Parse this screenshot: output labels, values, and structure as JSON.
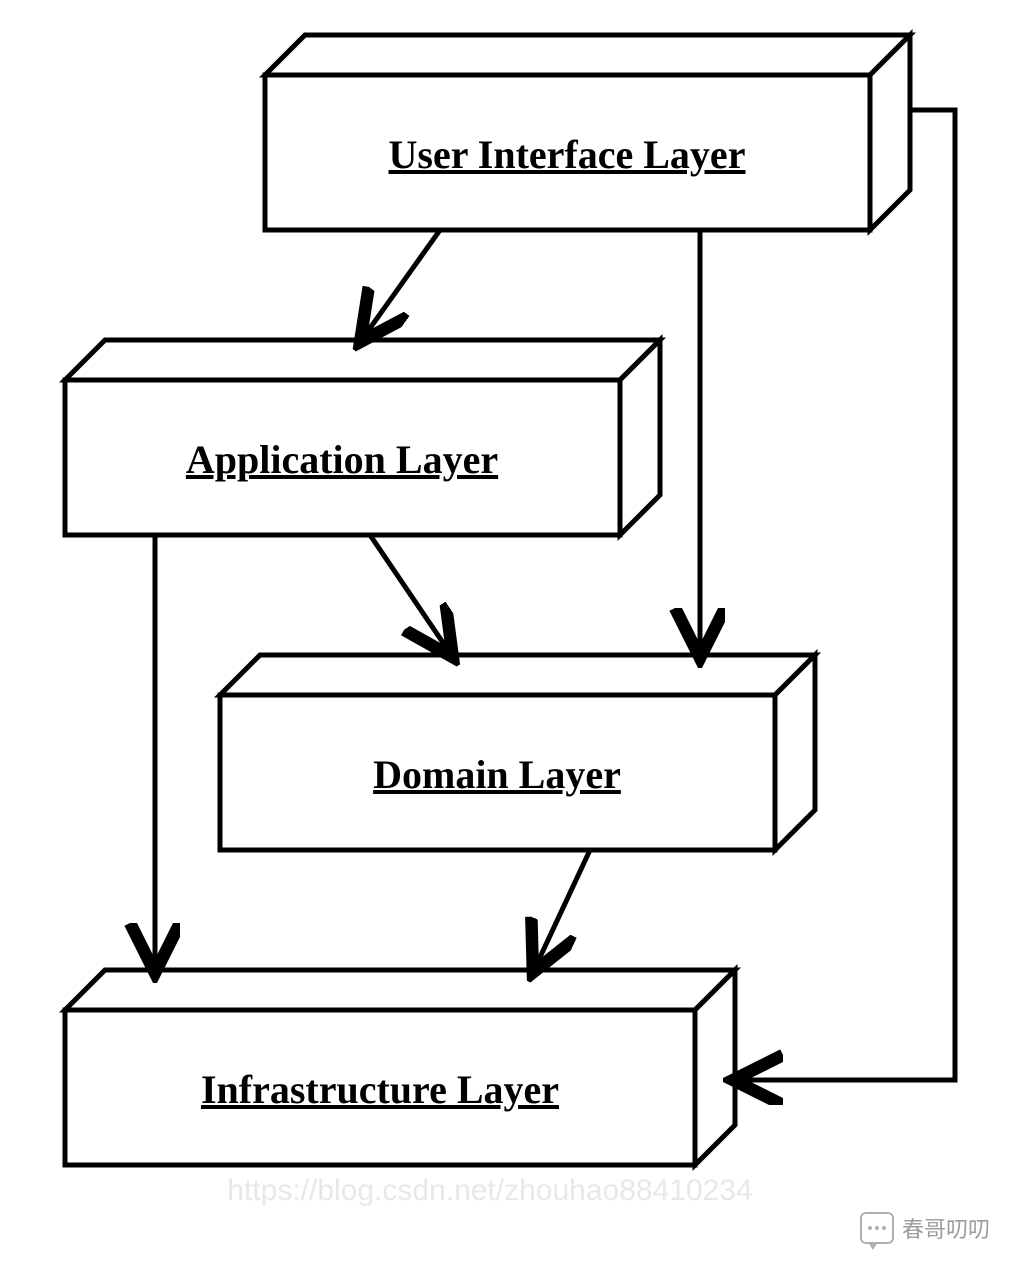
{
  "layers": {
    "ui": "User Interface Layer",
    "app": "Application Layer",
    "domain": "Domain Layer",
    "infra": "Infrastructure Layer"
  },
  "watermark": "https://blog.csdn.net/zhouhao88410234",
  "signature": "春哥叨叨"
}
